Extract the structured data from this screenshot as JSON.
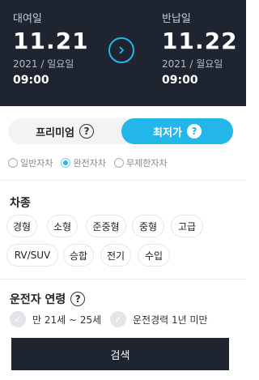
{
  "rental": {
    "label": "대여일",
    "date": "11.21",
    "sub": "2021 / 일요일",
    "time": "09:00"
  },
  "return": {
    "label": "반납일",
    "date": "11.22",
    "sub": "2021 / 월요일",
    "time": "09:00"
  },
  "arrow_icon": "chevron-right-icon",
  "tabs": {
    "premium": "프리미엄",
    "lowest": "최저가",
    "help": "?"
  },
  "insurance": {
    "options": [
      "일반자차",
      "완전자차",
      "무제한자차"
    ],
    "selected": "완전자차"
  },
  "car_type": {
    "title": "차종",
    "chips": [
      "경형",
      "소형",
      "준중형",
      "중형",
      "고급",
      "RV/SUV",
      "승합",
      "전기",
      "수입"
    ]
  },
  "driver_age": {
    "title": "운전자 연령",
    "help": "?",
    "options": [
      "만 21세 ~ 25세",
      "운전경력 1년 미만"
    ]
  },
  "search_label": "검색",
  "colors": {
    "accent": "#22b6ea",
    "header_bg": "#1e2530"
  }
}
